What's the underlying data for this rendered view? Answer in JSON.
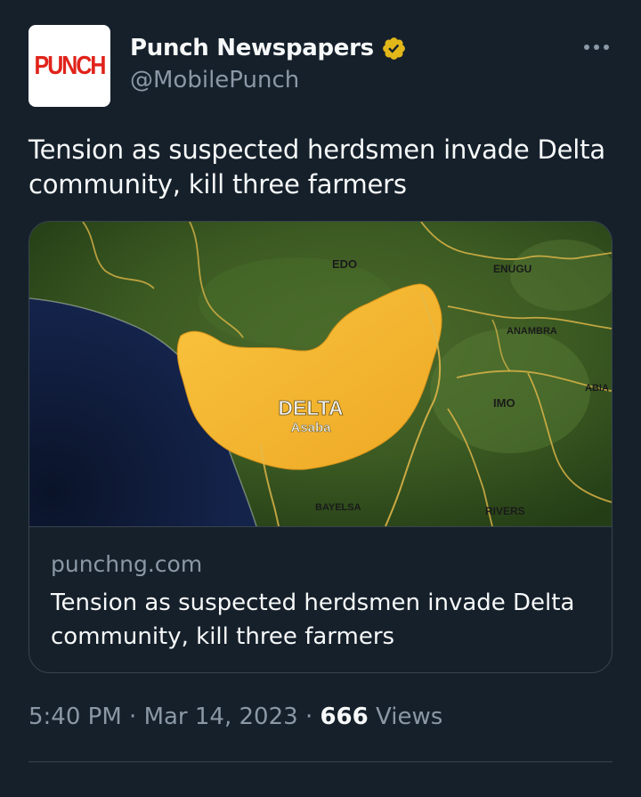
{
  "author": {
    "avatar_text": "PUNCH",
    "display_name": "Punch Newspapers",
    "handle": "@MobilePunch",
    "verified_icon": "verified-badge-gold"
  },
  "tweet": {
    "text": "Tension as suspected herdsmen invade Delta community, kill three farmers"
  },
  "card": {
    "map_labels": {
      "edo": "EDO",
      "enugu": "ENUGU",
      "anambra": "ANAMBRA",
      "abia": "ABIA",
      "imo": "IMO",
      "delta": "DELTA",
      "asaba": "Asaba",
      "bayelsa": "BAYELSA",
      "rivers": "RIVERS"
    },
    "domain": "punchng.com",
    "title": "Tension as suspected herdsmen invade Delta community, kill three farmers"
  },
  "meta": {
    "time": "5:40 PM",
    "separator": "·",
    "date": "Mar 14, 2023",
    "views_count": "666",
    "views_label": "Views"
  },
  "colors": {
    "background": "#15202b",
    "primary_text": "#f7f9f9",
    "secondary_text": "#8b98a5",
    "border": "#38444d",
    "verified": "#e2b719",
    "map_highlight": "#f5b82e",
    "punch_red": "#e0231b"
  },
  "icons": {
    "more": "more-horizontal-icon"
  }
}
